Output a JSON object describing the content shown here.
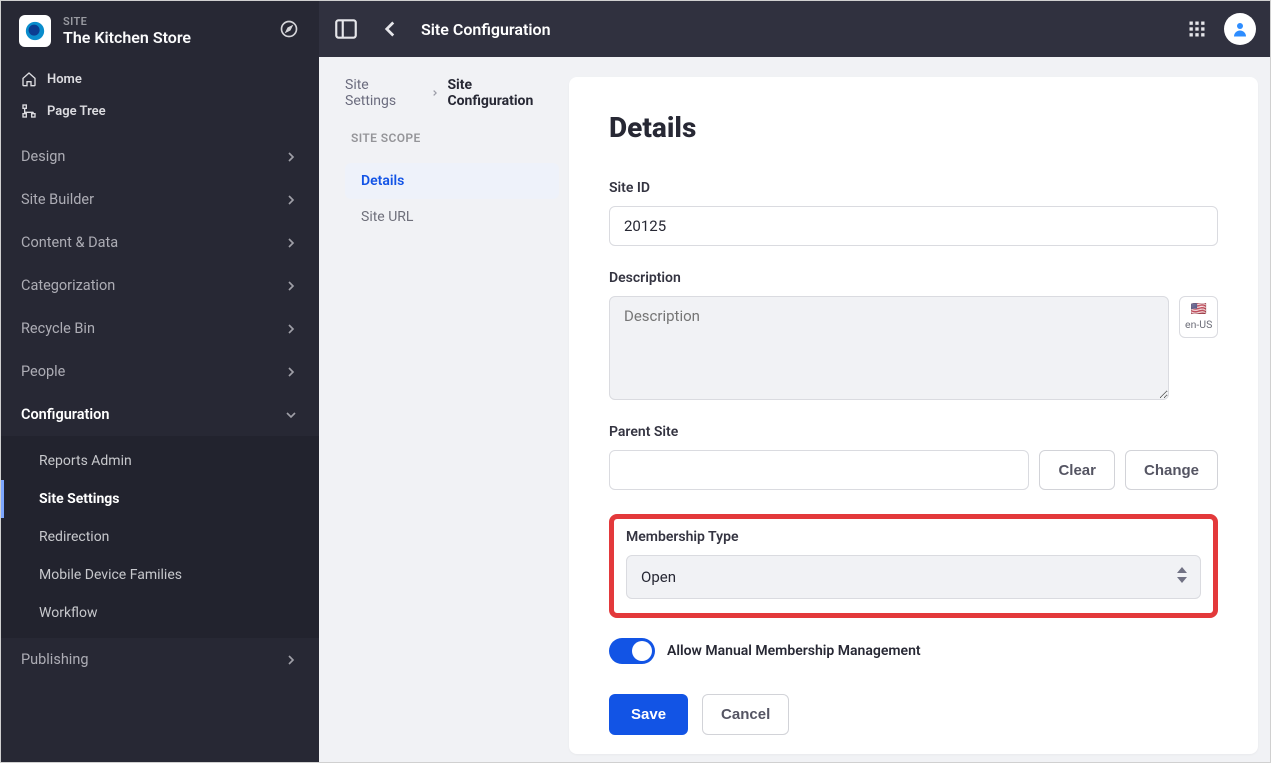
{
  "sidebar": {
    "label": "SITE",
    "siteName": "The Kitchen Store",
    "topLinks": {
      "home": "Home",
      "pageTree": "Page Tree"
    },
    "nav": [
      {
        "label": "Design"
      },
      {
        "label": "Site Builder"
      },
      {
        "label": "Content & Data"
      },
      {
        "label": "Categorization"
      },
      {
        "label": "Recycle Bin"
      },
      {
        "label": "People"
      },
      {
        "label": "Configuration"
      }
    ],
    "configSub": [
      {
        "label": "Reports Admin"
      },
      {
        "label": "Site Settings"
      },
      {
        "label": "Redirection"
      },
      {
        "label": "Mobile Device Families"
      },
      {
        "label": "Workflow"
      }
    ],
    "navTail": [
      {
        "label": "Publishing"
      }
    ]
  },
  "topbar": {
    "title": "Site Configuration"
  },
  "breadcrumb": {
    "parent": "Site Settings",
    "current": "Site Configuration"
  },
  "leftcol": {
    "scopeLabel": "SITE SCOPE",
    "items": [
      {
        "label": "Details"
      },
      {
        "label": "Site URL"
      }
    ]
  },
  "panel": {
    "title": "Details",
    "siteIdLabel": "Site ID",
    "siteIdValue": "20125",
    "descriptionLabel": "Description",
    "descriptionPlaceholder": "Description",
    "localeCode": "en-US",
    "localeFlag": "🇺🇸",
    "parentSiteLabel": "Parent Site",
    "clear": "Clear",
    "change": "Change",
    "membershipLabel": "Membership Type",
    "membershipValue": "Open",
    "toggleLabel": "Allow Manual Membership Management",
    "save": "Save",
    "cancel": "Cancel"
  }
}
